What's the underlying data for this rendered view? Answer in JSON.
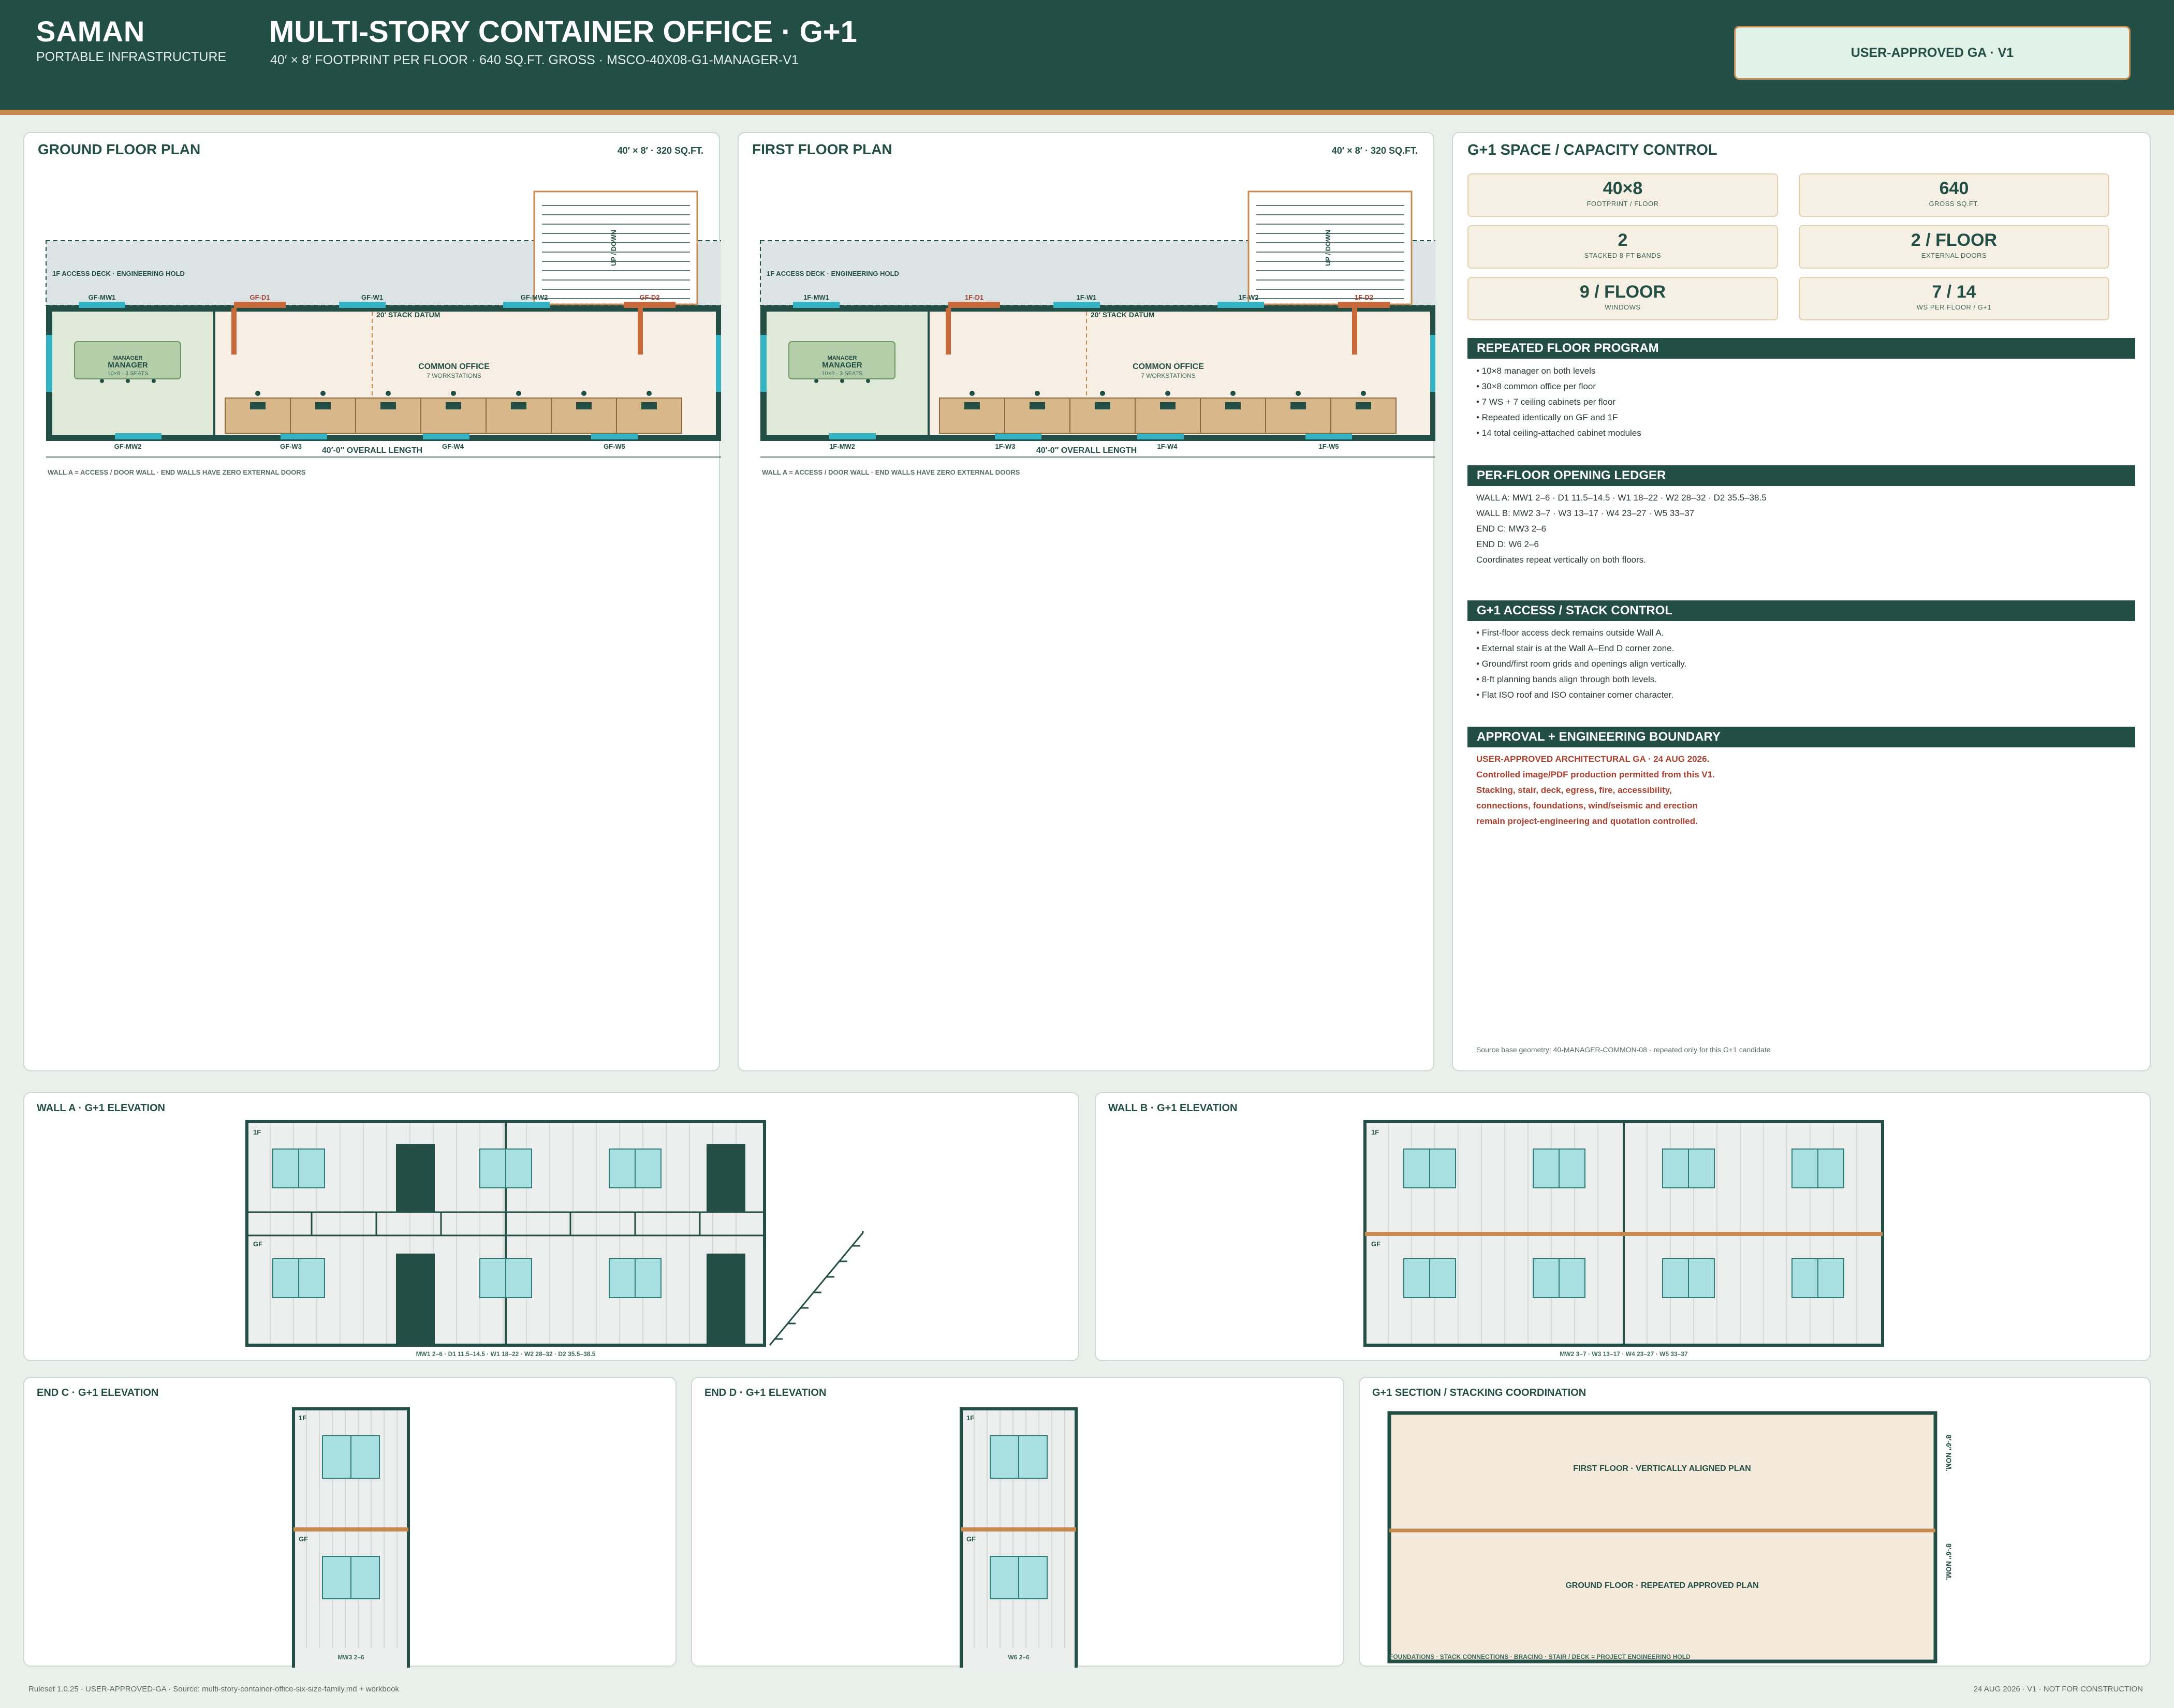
{
  "header": {
    "brand": "SAMAN",
    "brand_sub": "PORTABLE INFRASTRUCTURE",
    "title": "MULTI-STORY CONTAINER OFFICE · G+1",
    "subtitle": "40′ × 8′ FOOTPRINT PER FLOOR · 640 SQ.FT. GROSS · MSCO-40X08-G1-MANAGER-V1",
    "badge": "USER-APPROVED GA · V1"
  },
  "ground_floor": {
    "title": "GROUND FLOOR PLAN",
    "dims": "40′ × 8′ · 320 SQ.FT.",
    "deck_label": "1F ACCESS DECK · ENGINEERING HOLD",
    "stair_label": "UP / DOWN",
    "datum_label": "20′ STACK DATUM",
    "manager_label": "MANAGER",
    "manager_table": "MANAGER",
    "manager_seats": "10×8 · 3 SEATS",
    "office_label": "COMMON OFFICE",
    "office_sub": "7 WORKSTATIONS",
    "top_tags": [
      "GF-MW1",
      "GF-D1",
      "GF-W1",
      "GF-MW2",
      "GF-D2"
    ],
    "bottom_tags": [
      "GF-MW2",
      "GF-W3",
      "GF-W4",
      "GF-W5"
    ],
    "overall": "40′-0″ OVERALL LENGTH",
    "note": "WALL A = ACCESS / DOOR WALL · END WALLS HAVE ZERO EXTERNAL DOORS"
  },
  "first_floor": {
    "title": "FIRST FLOOR PLAN",
    "dims": "40′ × 8′ · 320 SQ.FT.",
    "deck_label": "1F ACCESS DECK · ENGINEERING HOLD",
    "stair_label": "UP / DOWN",
    "datum_label": "20′ STACK DATUM",
    "manager_label": "MANAGER",
    "manager_table": "MANAGER",
    "manager_seats": "10×8 · 3 SEATS",
    "office_label": "COMMON OFFICE",
    "office_sub": "7 WORKSTATIONS",
    "top_tags": [
      "1F-MW1",
      "1F-D1",
      "1F-W1",
      "1F-W2",
      "1F-D2"
    ],
    "bottom_tags": [
      "1F-MW2",
      "1F-W3",
      "1F-W4",
      "1F-W5"
    ],
    "overall": "40′-0″ OVERALL LENGTH",
    "note": "WALL A = ACCESS / DOOR WALL · END WALLS HAVE ZERO EXTERNAL DOORS"
  },
  "capacity": {
    "title": "G+1 SPACE / CAPACITY CONTROL",
    "tiles": [
      {
        "value": "40×8",
        "label": "FOOTPRINT / FLOOR"
      },
      {
        "value": "640",
        "label": "GROSS SQ.FT."
      },
      {
        "value": "2",
        "label": "STACKED 8-FT BANDS"
      },
      {
        "value": "2 / FLOOR",
        "label": "EXTERNAL DOORS"
      },
      {
        "value": "9 / FLOOR",
        "label": "WINDOWS"
      },
      {
        "value": "7 / 14",
        "label": "WS PER FLOOR / G+1"
      }
    ],
    "program_head": "REPEATED FLOOR PROGRAM",
    "program": [
      "• 10×8 manager on both levels",
      "• 30×8 common office per floor",
      "• 7 WS + 7 ceiling cabinets per floor",
      "• Repeated identically on GF and 1F",
      "• 14 total ceiling-attached cabinet modules"
    ],
    "ledger_head": "PER-FLOOR OPENING LEDGER",
    "ledger": [
      "WALL A: MW1 2–6 · D1 11.5–14.5 · W1 18–22 · W2 28–32 · D2 35.5–38.5",
      "WALL B: MW2 3–7 · W3 13–17 · W4 23–27 · W5 33–37",
      "END C: MW3 2–6",
      "END D: W6 2–6",
      "Coordinates repeat vertically on both floors."
    ],
    "access_head": "G+1 ACCESS / STACK CONTROL",
    "access": [
      "• First-floor access deck remains outside Wall A.",
      "• External stair is at the Wall A–End D corner zone.",
      "• Ground/first room grids and openings align vertically.",
      "• 8-ft planning bands align through both levels.",
      "• Flat ISO roof and ISO container corner character."
    ],
    "approval_head": "APPROVAL + ENGINEERING BOUNDARY",
    "approval": [
      "USER-APPROVED ARCHITECTURAL GA · 24 AUG 2026.",
      "Controlled image/PDF production permitted from this V1.",
      "Stacking, stair, deck, egress, fire, accessibility,",
      "connections, foundations, wind/seismic and erection",
      "remain project-engineering and quotation controlled."
    ],
    "source": "Source base geometry: 40-MANAGER-COMMON-08 · repeated only for this G+1 candidate"
  },
  "wall_a": {
    "title": "WALL A · G+1 ELEVATION",
    "caption": "MW1 2–6 · D1 11.5–14.5 · W1 18–22 · W2 28–32 · D2 35.5–38.5",
    "top_level": "1F",
    "bottom_level": "GF"
  },
  "wall_b": {
    "title": "WALL B · G+1 ELEVATION",
    "caption": "MW2 3–7 · W3 13–17 · W4 23–27 · W5 33–37",
    "top_level": "1F",
    "bottom_level": "GF"
  },
  "end_c": {
    "title": "END C · G+1 ELEVATION",
    "caption": "MW3 2–6",
    "top_level": "1F",
    "bottom_level": "GF"
  },
  "end_d": {
    "title": "END D · G+1 ELEVATION",
    "caption": "W6 2–6",
    "top_level": "1F",
    "bottom_level": "GF"
  },
  "section": {
    "title": "G+1 SECTION / STACKING COORDINATION",
    "upper": "FIRST FLOOR · VERTICALLY ALIGNED PLAN",
    "lower": "GROUND FLOOR · REPEATED APPROVED PLAN",
    "dim_top": "8′-6″ NOM.",
    "dim_bottom": "8′-6″ NOM.",
    "note": "FOUNDATIONS · STACK CONNECTIONS · BRACING · STAIR / DECK = PROJECT ENGINEERING HOLD"
  },
  "footer": {
    "left": "Ruleset 1.0.25 · USER-APPROVED-GA · Source: multi-story-container-office-six-size-family.md + workbook",
    "right": "24 AUG 2026 · V1 · NOT FOR CONSTRUCTION"
  },
  "colors": {
    "primary": "#234e45",
    "accent": "#c98a4f",
    "window": "#a9dfe0",
    "manager_room": "#dfe9d8",
    "office_room": "#f7efe3",
    "cabinet": "#d8b88b",
    "warning": "#a8412f"
  }
}
